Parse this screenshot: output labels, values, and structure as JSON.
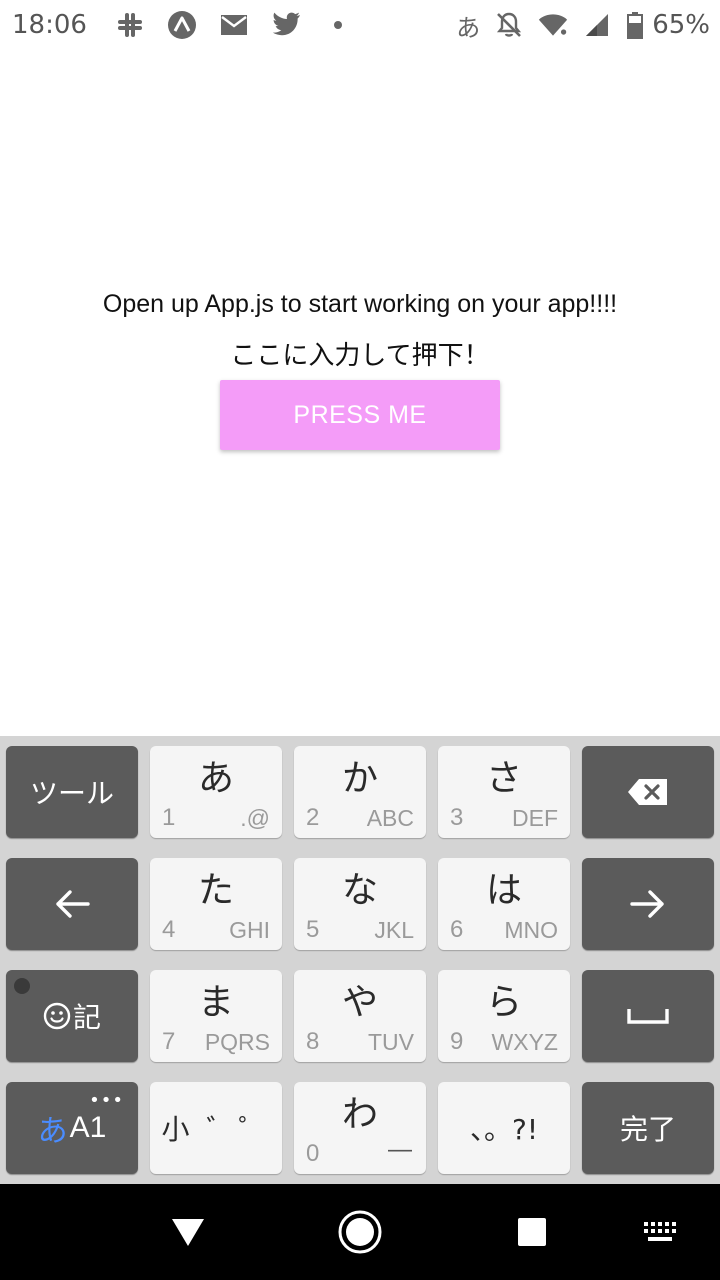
{
  "status_bar": {
    "time": "18:06",
    "left_icons": [
      "slack-icon",
      "expo-icon",
      "mail-icon",
      "twitter-icon",
      "notification-dot-icon"
    ],
    "ime_indicator": "あ",
    "right_icons": [
      "bell-off-icon",
      "wifi-icon",
      "cell-signal-icon",
      "battery-icon"
    ],
    "battery_percent": "65%"
  },
  "app": {
    "welcome_text": "Open up App.js to start working on your app!!!!",
    "prompt_text": "ここに入力して押下！",
    "button_label": "PRESS ME",
    "button_color": "#f49cf8"
  },
  "keyboard": {
    "tool_label": "ツール",
    "rows": [
      {
        "kana": "あ",
        "num": "1",
        "letters": ".@"
      },
      {
        "kana": "か",
        "num": "2",
        "letters": "ABC"
      },
      {
        "kana": "さ",
        "num": "3",
        "letters": "DEF"
      },
      {
        "kana": "た",
        "num": "4",
        "letters": "GHI"
      },
      {
        "kana": "な",
        "num": "5",
        "letters": "JKL"
      },
      {
        "kana": "は",
        "num": "6",
        "letters": "MNO"
      },
      {
        "kana": "ま",
        "num": "7",
        "letters": "PQRS"
      },
      {
        "kana": "や",
        "num": "8",
        "letters": "TUV"
      },
      {
        "kana": "ら",
        "num": "9",
        "letters": "WXYZ"
      }
    ],
    "emoji_key_label": "記",
    "mode_kana": "あ",
    "mode_latin": "A1",
    "more_dots": "•••",
    "small_kana_label": "小 ゛゜",
    "wa_kana": "わ",
    "wa_num": "0",
    "wa_extra": "—",
    "punct_label": "、。?!",
    "done_label": "完了",
    "accent_color": "#4a8cff"
  },
  "nav_bar": {
    "icons": [
      "back-triangle-icon",
      "home-circle-icon",
      "recents-square-icon",
      "keyboard-switch-icon"
    ]
  }
}
